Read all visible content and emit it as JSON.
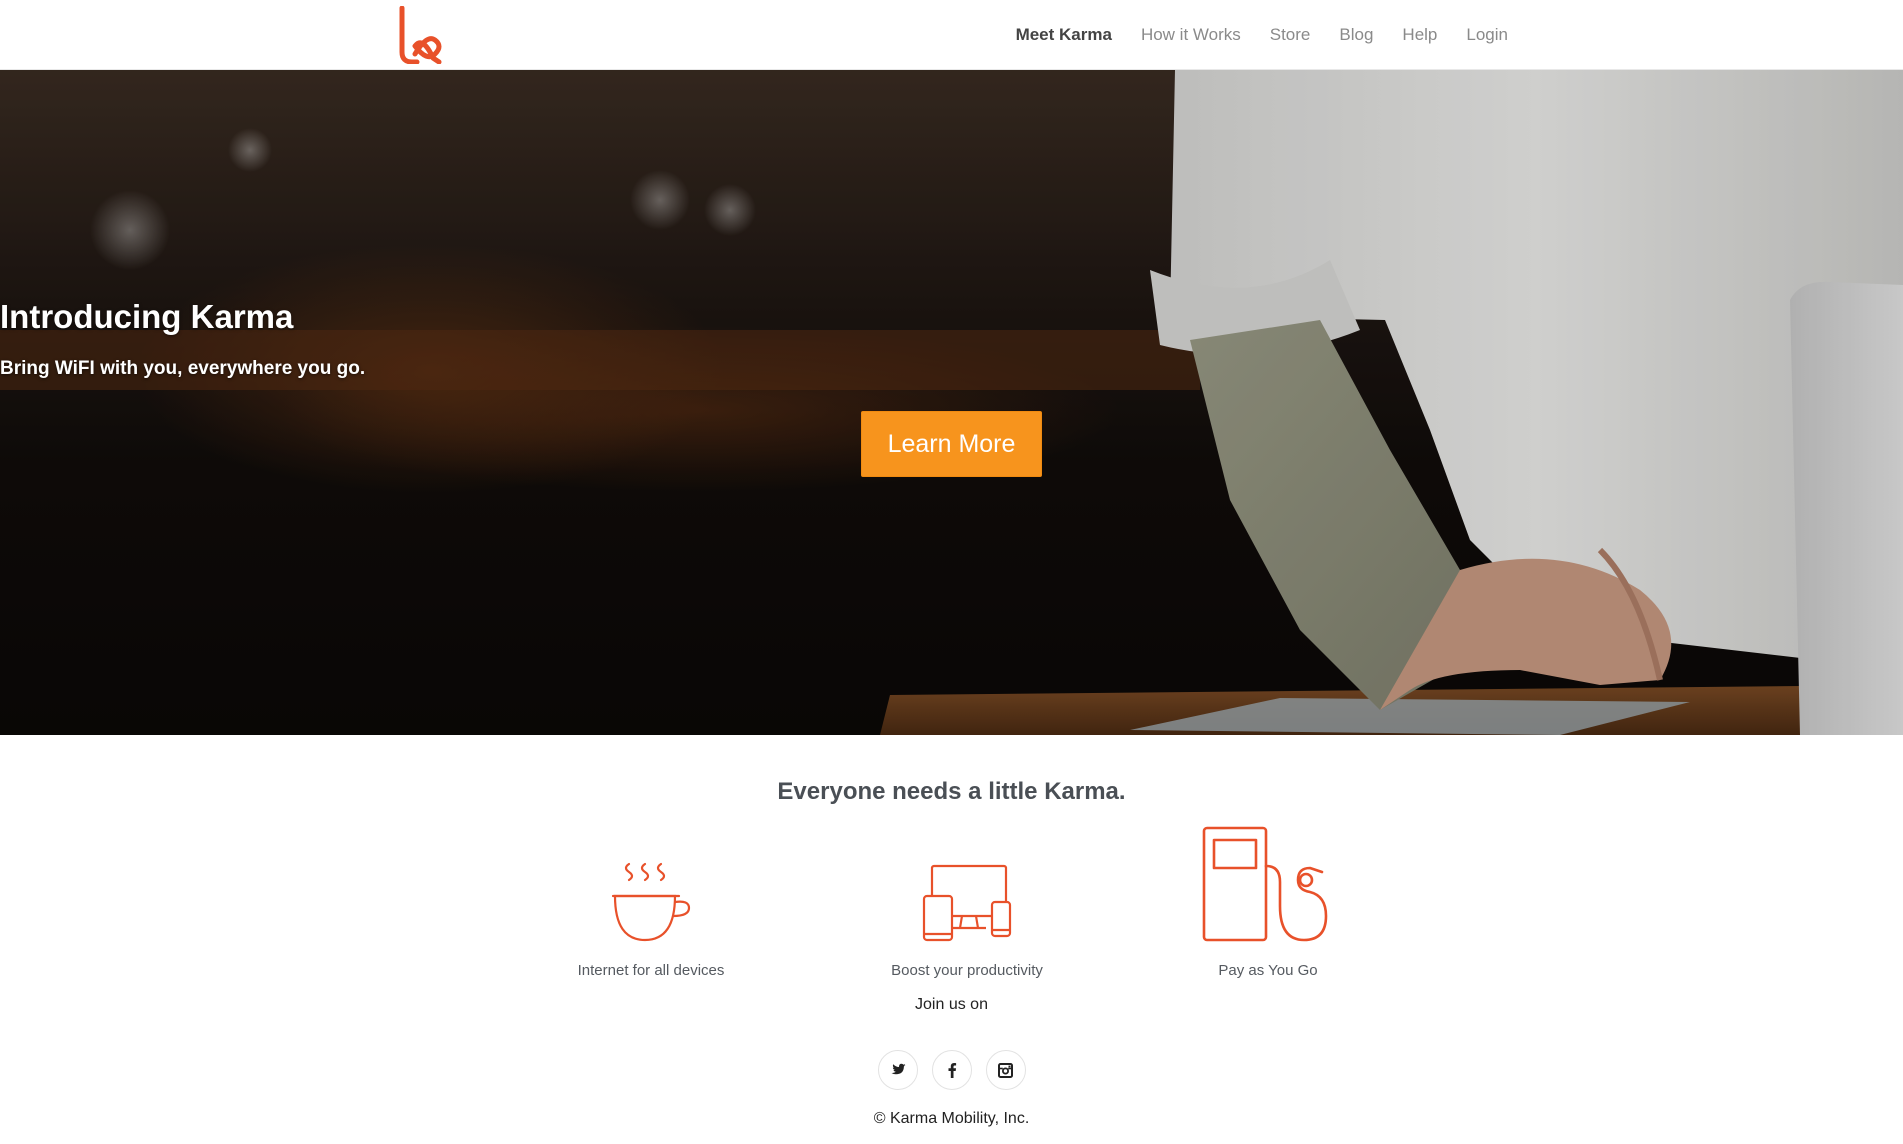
{
  "brand": {
    "accent_color": "#e8512a",
    "button_color": "#f7941d"
  },
  "nav": {
    "items": [
      {
        "label": "Meet Karma",
        "active": true
      },
      {
        "label": "How it Works",
        "active": false
      },
      {
        "label": "Store",
        "active": false
      },
      {
        "label": "Blog",
        "active": false
      },
      {
        "label": "Help",
        "active": false
      },
      {
        "label": "Login",
        "active": false
      }
    ]
  },
  "hero": {
    "title": "Introducing Karma",
    "subtitle": "Bring WiFI with you, everywhere you go.",
    "cta_label": "Learn More"
  },
  "features": {
    "tagline": "Everyone needs a little Karma.",
    "items": [
      {
        "label": "Internet for all devices",
        "icon": "coffee-cup-icon"
      },
      {
        "label": "Boost your productivity",
        "icon": "devices-icon"
      },
      {
        "label": "Pay as You Go",
        "icon": "fuel-pump-icon"
      }
    ]
  },
  "footer": {
    "join_label": "Join us on",
    "socials": [
      {
        "name": "Twitter",
        "icon": "twitter-icon"
      },
      {
        "name": "Facebook",
        "icon": "facebook-icon"
      },
      {
        "name": "Instagram",
        "icon": "instagram-icon"
      }
    ],
    "copyright": "© Karma Mobility, Inc."
  }
}
